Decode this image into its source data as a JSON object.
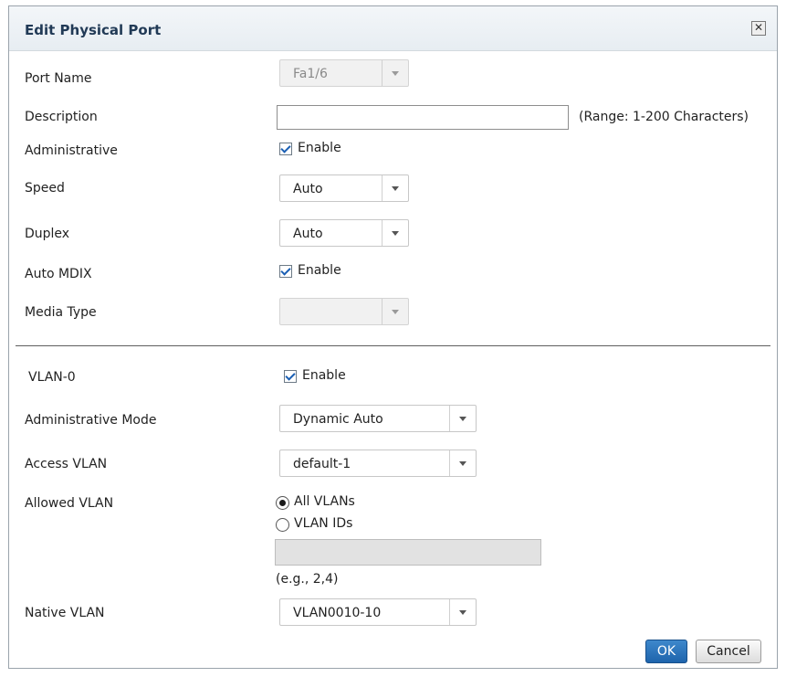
{
  "dialog": {
    "title": "Edit Physical Port",
    "close_glyph": "✕",
    "close_icon": "close-icon"
  },
  "port_name": {
    "label": "Port Name",
    "value": "Fa1/6"
  },
  "description": {
    "label": "Description",
    "value": "",
    "range": "(Range: 1-200 Characters)"
  },
  "administrative": {
    "label": "Administrative",
    "checkbox_label": "Enable",
    "checked": true
  },
  "speed": {
    "label": "Speed",
    "value": "Auto"
  },
  "duplex": {
    "label": "Duplex",
    "value": "Auto"
  },
  "auto_mdix": {
    "label": "Auto MDIX",
    "checkbox_label": "Enable",
    "checked": true
  },
  "media_type": {
    "label": "Media Type",
    "value": ""
  },
  "vlan0": {
    "label": "VLAN-0",
    "checkbox_label": "Enable",
    "checked": true
  },
  "admin_mode": {
    "label": "Administrative Mode",
    "value": "Dynamic Auto"
  },
  "access_vlan": {
    "label": "Access VLAN",
    "value": "default-1"
  },
  "allowed_vlan": {
    "label": "Allowed VLAN",
    "options": [
      "All VLANs",
      "VLAN IDs"
    ],
    "selected": "All VLANs",
    "ids_value": "",
    "hint": "(e.g., 2,4)"
  },
  "native_vlan": {
    "label": "Native VLAN",
    "value": "VLAN0010-10"
  },
  "buttons": {
    "ok": "OK",
    "cancel": "Cancel"
  },
  "colors": {
    "primary": "#2a74bd",
    "title": "#213a56"
  }
}
